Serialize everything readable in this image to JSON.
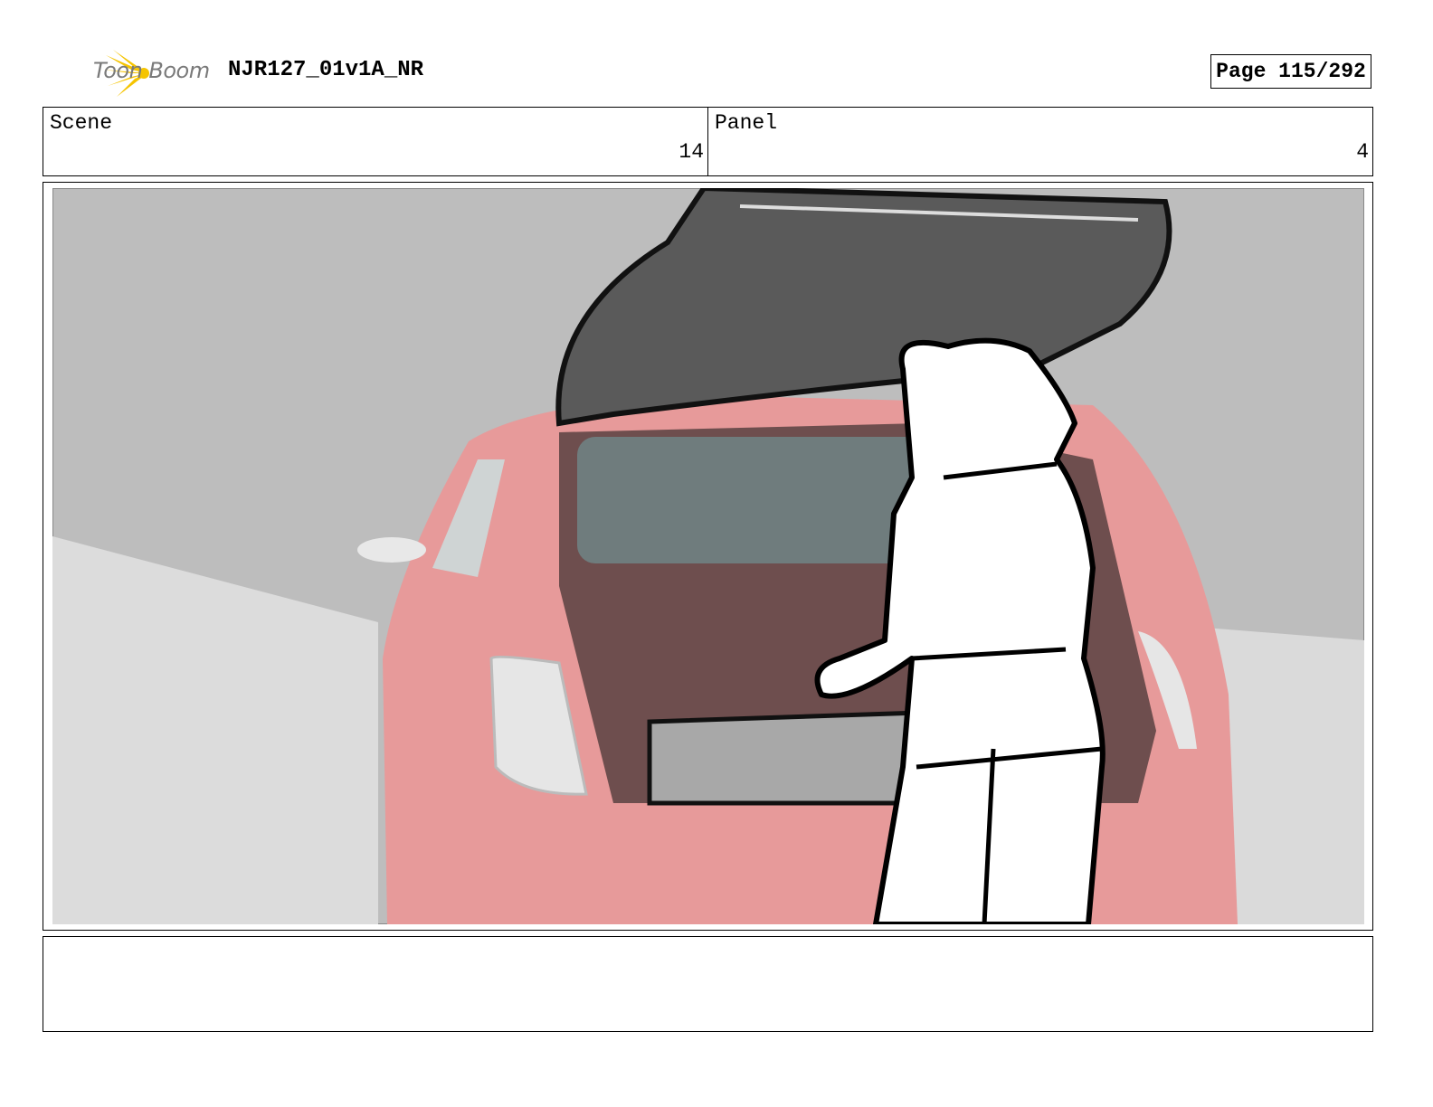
{
  "header": {
    "logo_text": "Toon Boom",
    "project_title": "NJR127_01v1A_NR",
    "page_label": "Page 115/292"
  },
  "info": {
    "scene_label": "Scene",
    "scene_value": "14",
    "panel_label": "Panel",
    "panel_value": "4"
  },
  "notes": {
    "text": ""
  },
  "colors": {
    "logo_accent": "#f5c400",
    "car_red": "#e58a8a",
    "trunk_lid": "#5a5a5a"
  }
}
